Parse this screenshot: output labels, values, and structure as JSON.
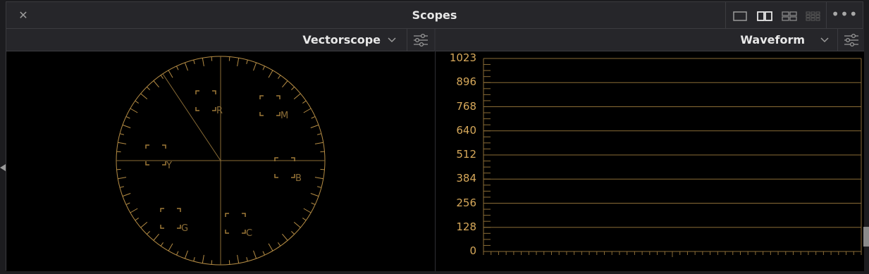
{
  "window": {
    "title": "Scopes",
    "close_glyph": "✕",
    "more_glyph": "•••",
    "layout_options": [
      "single-view-icon",
      "dual-view-icon",
      "quad-view-icon",
      "grid-view-icon"
    ],
    "selected_layout": "dual-view-icon"
  },
  "vectorscope": {
    "name": "Vectorscope",
    "targets": [
      "R",
      "M",
      "Y",
      "B",
      "G",
      "C"
    ]
  },
  "waveform": {
    "name": "Waveform",
    "scale_labels": [
      "1023",
      "896",
      "768",
      "640",
      "512",
      "384",
      "256",
      "128",
      "0"
    ]
  },
  "colors": {
    "graticule": "#c79a4a",
    "panel_bg": "#000000",
    "chrome_bg": "#26262a"
  }
}
